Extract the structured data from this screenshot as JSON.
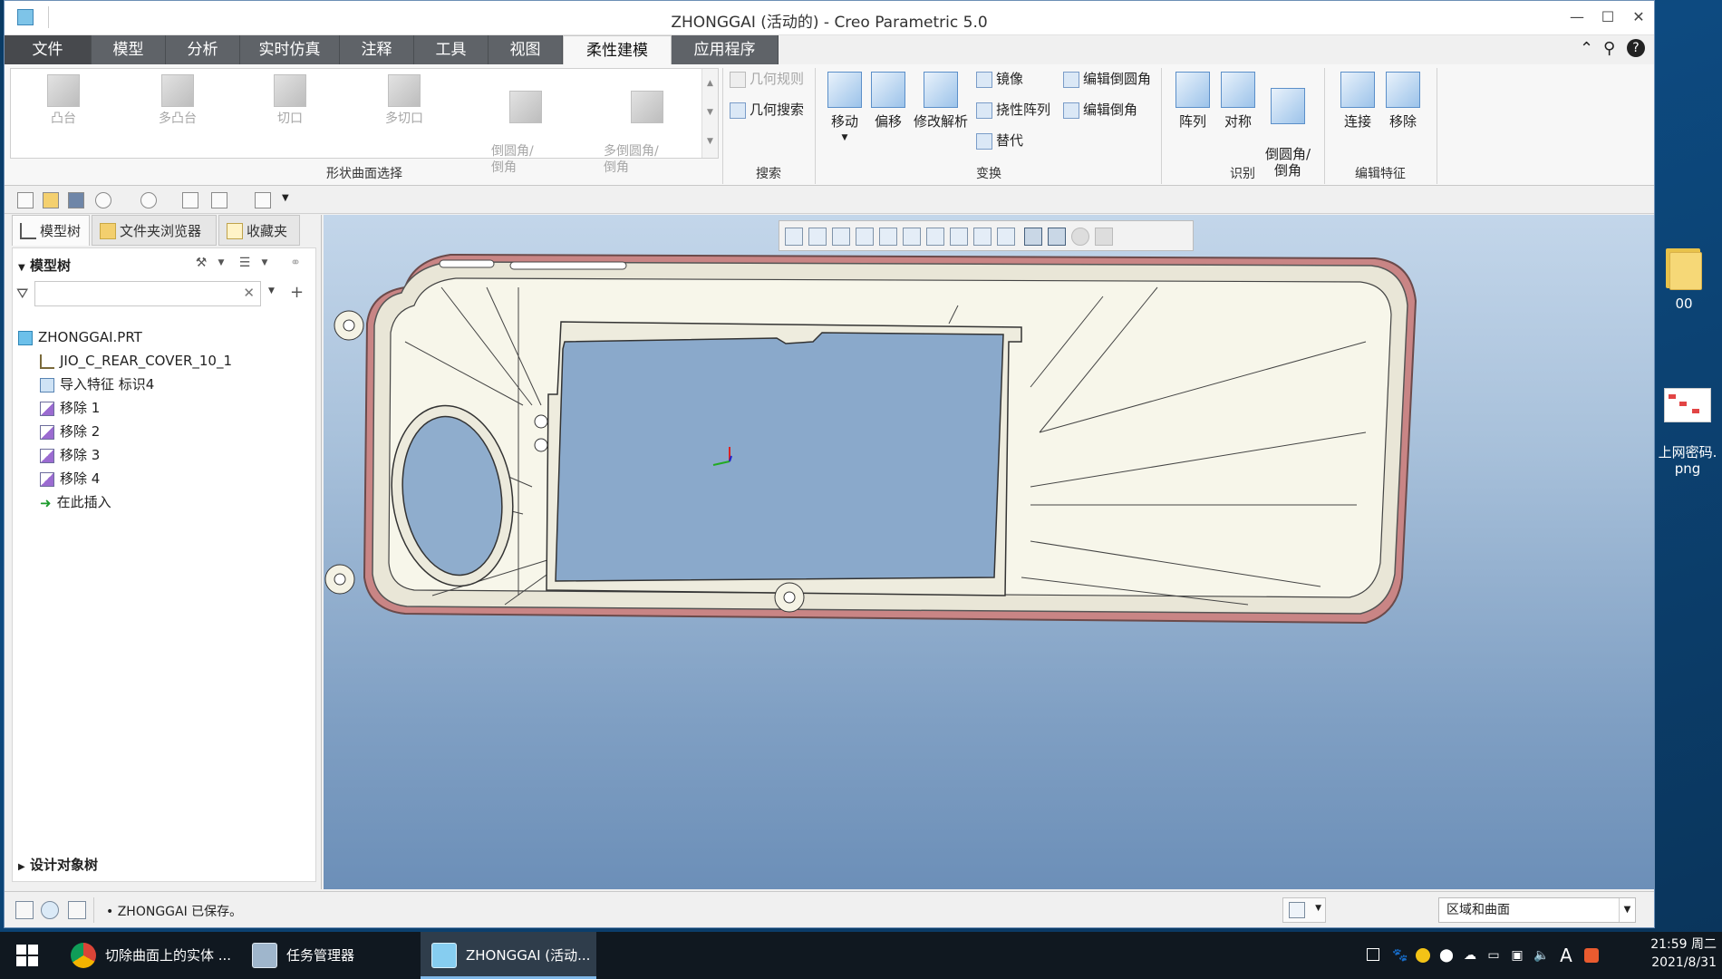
{
  "desktop": {
    "icons": [
      {
        "label": "00"
      },
      {
        "label": "上网密码.\npng"
      }
    ]
  },
  "window": {
    "title": "ZHONGGAI (活动的) - Creo Parametric 5.0",
    "controls": {
      "minimize": "—",
      "maximize": "☐",
      "close": "✕"
    }
  },
  "tabs": [
    {
      "label": "文件"
    },
    {
      "label": "模型"
    },
    {
      "label": "分析"
    },
    {
      "label": "实时仿真"
    },
    {
      "label": "注释"
    },
    {
      "label": "工具"
    },
    {
      "label": "视图"
    },
    {
      "label": "柔性建模"
    },
    {
      "label": "应用程序"
    }
  ],
  "active_tab": "柔性建模",
  "tab_right": {
    "collapse": "⌃",
    "search": "⚲",
    "help": "?"
  },
  "ribbon": {
    "gallery": {
      "items": [
        {
          "label": "凸台"
        },
        {
          "label": "多凸台"
        },
        {
          "label": "切口"
        },
        {
          "label": "多切口"
        },
        {
          "label": "倒圆角/\n倒角"
        },
        {
          "label": "多倒圆角/\n倒角"
        }
      ],
      "group_label": "形状曲面选择"
    },
    "search": {
      "geometry_rule": "几何规则",
      "geometry_search": "几何搜索",
      "group_label": "搜索"
    },
    "transform": {
      "move": "移动",
      "offset": "偏移",
      "modify_analytic": "修改解析",
      "mirror": "镜像",
      "flex_pattern": "挠性阵列",
      "substitute": "替代",
      "edit_round": "编辑倒圆角",
      "edit_chamfer": "编辑倒角",
      "group_label": "变换"
    },
    "recognize": {
      "pattern": "阵列",
      "symmetry": "对称",
      "round_chamfer": "倒圆角/\n倒角",
      "group_label": "识别"
    },
    "edit_feature": {
      "attach": "连接",
      "remove": "移除",
      "group_label": "编辑特征"
    }
  },
  "left_panel": {
    "tabs": [
      {
        "label": "模型树"
      },
      {
        "label": "文件夹浏览器"
      },
      {
        "label": "收藏夹"
      }
    ],
    "tree_header": "模型树",
    "filter_placeholder": "",
    "tree_items": [
      {
        "label": "ZHONGGAI.PRT",
        "icon": "part-icon",
        "indent": 0
      },
      {
        "label": "JIO_C_REAR_COVER_10_1",
        "icon": "csys-icon",
        "indent": 1
      },
      {
        "label": "导入特征 标识4",
        "icon": "import-feature-icon",
        "indent": 1
      },
      {
        "label": "移除 1",
        "icon": "remove-feature-icon",
        "indent": 1
      },
      {
        "label": "移除 2",
        "icon": "remove-feature-icon",
        "indent": 1
      },
      {
        "label": "移除 3",
        "icon": "remove-feature-icon",
        "indent": 1
      },
      {
        "label": "移除 4",
        "icon": "remove-feature-icon",
        "indent": 1
      },
      {
        "label": "在此插入",
        "icon": "insert-here-icon",
        "indent": 1
      }
    ],
    "design_tree": "设计对象树"
  },
  "status": {
    "message": "ZHONGGAI 已保存。",
    "selection_filter": "区域和曲面"
  },
  "taskbar": {
    "items": [
      {
        "label": "切除曲面上的实体 ..."
      },
      {
        "label": "任务管理器"
      },
      {
        "label": "ZHONGGAI (活动..."
      }
    ],
    "ime": "A",
    "time": "21:59 周二",
    "date": "2021/8/31"
  },
  "colors": {
    "tab_bg": "#5f6368",
    "graphics_top": "#c3d6ea",
    "graphics_bottom": "#6c8fb8",
    "model_fill": "#f7f6ea",
    "model_outer_edge": "#c98585"
  }
}
